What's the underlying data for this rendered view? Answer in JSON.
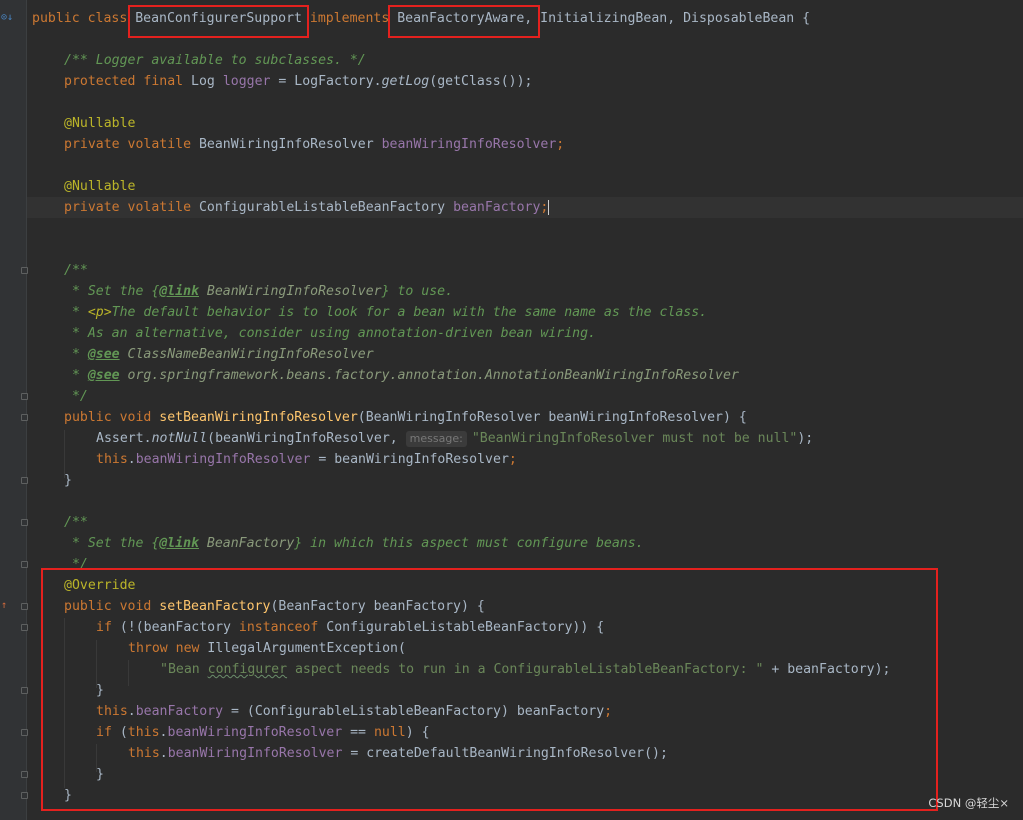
{
  "editor": {
    "lines": {
      "l01": {
        "kw1": "public class ",
        "name": "BeanConfigurerSupport",
        "kw2": " implements ",
        "iface1": "BeanFactoryAware",
        "rest": ", InitializingBean, DisposableBean {"
      },
      "l03": "/** Logger available to subclasses. */",
      "l04": {
        "kw": "protected final ",
        "type": "Log ",
        "field": "logger",
        "eq": " = LogFactory.",
        "method": "getLog",
        "rest": "(getClass());"
      },
      "l06": "@Nullable",
      "l07": {
        "kw": "private volatile ",
        "type": "BeanWiringInfoResolver ",
        "field": "beanWiringInfoResolver",
        "semi": ";"
      },
      "l09": "@Nullable",
      "l10": {
        "kw": "private volatile ",
        "type": "ConfigurableListableBeanFactory ",
        "field": "beanFactory",
        "semi": ";"
      },
      "l13": "/**",
      "l14": {
        "a": " * Set the {",
        "tag": "@link",
        "ref": " BeanWiringInfoResolver",
        "b": "} to use."
      },
      "l15": {
        "a": " * ",
        "tag": "<p>",
        "b": "The default behavior is to look for a bean with the same name as the class."
      },
      "l16": " * As an alternative, consider using annotation-driven bean wiring.",
      "l17": {
        "a": " * ",
        "tag": "@see",
        "ref": " ClassNameBeanWiringInfoResolver"
      },
      "l18": {
        "a": " * ",
        "tag": "@see",
        "ref": " org.springframework.beans.factory.annotation.AnnotationBeanWiringInfoResolver"
      },
      "l19": " */",
      "l20": {
        "kw": "public void ",
        "method": "setBeanWiringInfoResolver",
        "rest": "(BeanWiringInfoResolver beanWiringInfoResolver) {"
      },
      "l21": {
        "a": "Assert.",
        "method": "notNull",
        "b": "(beanWiringInfoResolver, ",
        "hint": "message:",
        "str": "\"BeanWiringInfoResolver must not be null\"",
        "c": ");"
      },
      "l22": {
        "kw": "this",
        "dot": ".",
        "field": "beanWiringInfoResolver",
        "rest": " = beanWiringInfoResolver",
        "semi": ";"
      },
      "l23": "}",
      "l25": "/**",
      "l26": {
        "a": " * Set the {",
        "tag": "@link",
        "ref": " BeanFactory",
        "b": "} in which this aspect must configure beans."
      },
      "l27": " */",
      "l28": "@Override",
      "l29": {
        "kw": "public void ",
        "method": "setBeanFactory",
        "rest": "(BeanFactory beanFactory) {"
      },
      "l30": {
        "kw": "if ",
        "a": "(!(beanFactory ",
        "kw2": "instanceof",
        "b": " ConfigurableListableBeanFactory)) {"
      },
      "l31": {
        "kw": "throw new ",
        "rest": "IllegalArgumentException("
      },
      "l32": {
        "s1": "\"Bean ",
        "sq": "configurer",
        "s2": " aspect needs to run in a ConfigurableListableBeanFactory: \"",
        "rest": " + beanFactory);"
      },
      "l33": "}",
      "l34": {
        "kw": "this",
        "dot": ".",
        "field": "beanFactory",
        "rest": " = (ConfigurableListableBeanFactory) beanFactory",
        "semi": ";"
      },
      "l35": {
        "kw": "if ",
        "a": "(",
        "kw2": "this",
        "dot": ".",
        "field": "beanWiringInfoResolver",
        "b": " == ",
        "kw3": "null",
        "c": ") {"
      },
      "l36": {
        "kw": "this",
        "dot": ".",
        "field": "beanWiringInfoResolver",
        "rest": " = createDefaultBeanWiringInfoResolver();"
      },
      "l37": "}",
      "l38": "}"
    }
  },
  "watermark": "CSDN @轻尘×",
  "colors": {
    "background": "#2b2b2b",
    "keyword": "#cc7832",
    "string": "#6a8759",
    "field": "#9876aa",
    "method": "#ffc66d",
    "annotation": "#bbb529",
    "highlight_box": "#e4211e"
  }
}
